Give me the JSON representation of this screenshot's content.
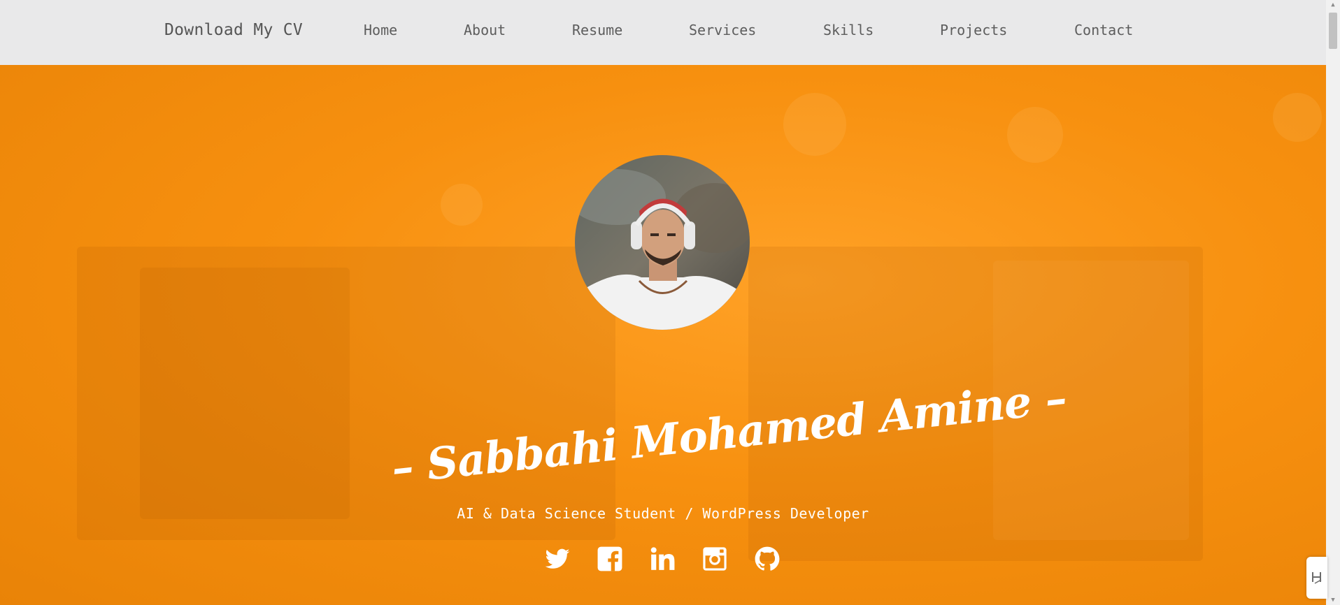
{
  "navbar": {
    "brand": "Download My CV",
    "items": [
      {
        "label": "Home"
      },
      {
        "label": "About"
      },
      {
        "label": "Resume"
      },
      {
        "label": "Services"
      },
      {
        "label": "Skills"
      },
      {
        "label": "Projects"
      },
      {
        "label": "Contact"
      }
    ]
  },
  "hero": {
    "name": "– Sabbahi Mohamed Amine –",
    "subtitle": "AI & Data Science Student / WordPress Developer",
    "accent_color": "#f7900f",
    "social_icons": [
      "twitter-icon",
      "facebook-icon",
      "linkedin-icon",
      "instagram-icon",
      "github-icon"
    ]
  },
  "widget": {
    "icon": "chat-widget-icon"
  }
}
